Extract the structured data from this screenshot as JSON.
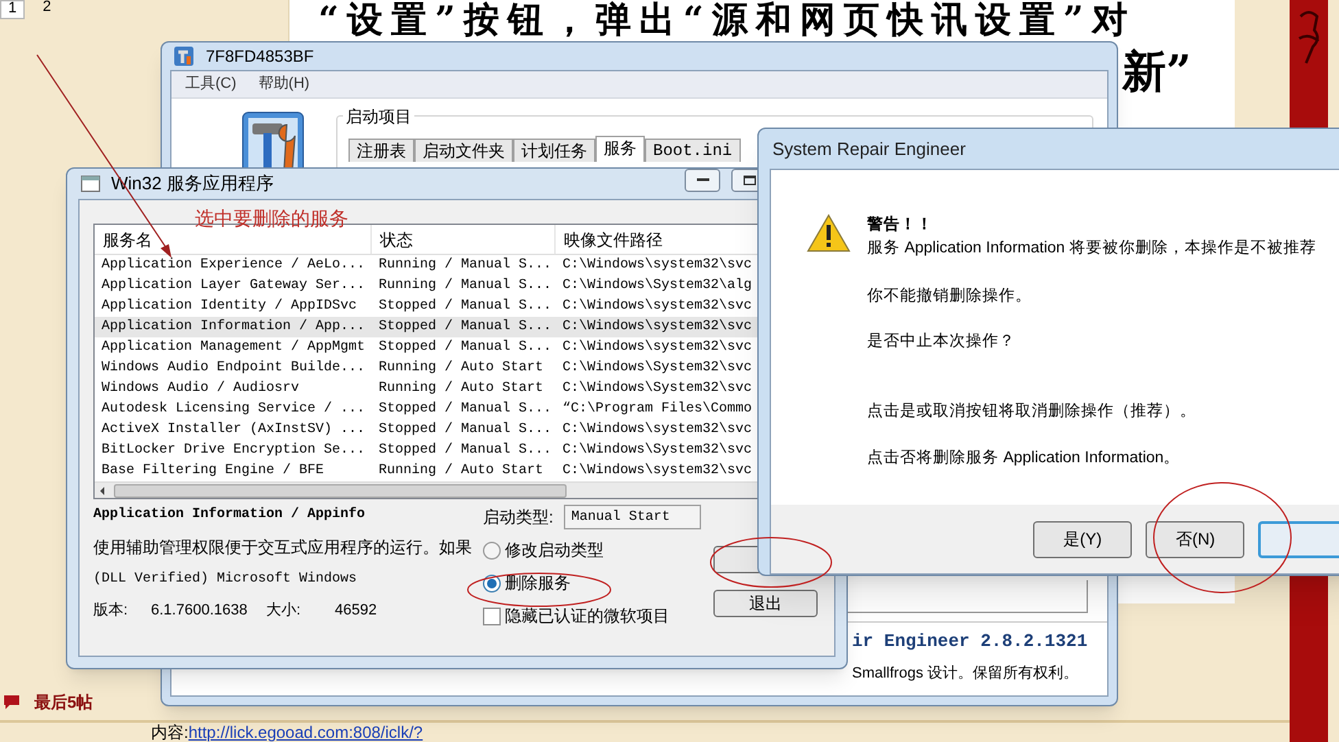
{
  "page": {
    "pagination": [
      {
        "label": "1",
        "selected": true
      },
      {
        "label": "2",
        "selected": false
      }
    ],
    "heading_line_1": "“设置”按钮，弹出“源和网页快讯设置”对",
    "heading_line_2": "新”",
    "recent_posts": "最后5帖",
    "content_label": "内容:",
    "content_link": "http://lick.egooad.com:808/iclk/?"
  },
  "main_window": {
    "title": "7F8FD4853BF",
    "menu": [
      "工具(C)",
      "帮助(H)"
    ],
    "group_title": "启动项目",
    "tabs": [
      {
        "label": "注册表",
        "selected": false
      },
      {
        "label": "启动文件夹",
        "selected": false
      },
      {
        "label": "计划任务",
        "selected": false
      },
      {
        "label": "服务",
        "selected": true
      },
      {
        "label": "Boot.ini",
        "selected": false
      }
    ],
    "product": "ir Engineer 2.8.2.1321",
    "copyright": "Smallfrogs 设计。保留所有权利。"
  },
  "services_window": {
    "title": "Win32 服务应用程序",
    "annotation": "选中要删除的服务",
    "table": {
      "columns": [
        "服务名",
        "状态",
        "映像文件路径"
      ],
      "rows": [
        {
          "cells": [
            "Application Experience / AeLo...",
            "Running / Manual S...",
            "C:\\Windows\\system32\\svc"
          ],
          "selected": false
        },
        {
          "cells": [
            "Application Layer Gateway Ser...",
            "Running / Manual S...",
            "C:\\Windows\\System32\\alg"
          ],
          "selected": false
        },
        {
          "cells": [
            "Application Identity / AppIDSvc",
            "Stopped / Manual S...",
            "C:\\Windows\\system32\\svc"
          ],
          "selected": false
        },
        {
          "cells": [
            "Application Information / App...",
            "Stopped / Manual S...",
            "C:\\Windows\\system32\\svc"
          ],
          "selected": true
        },
        {
          "cells": [
            "Application Management / AppMgmt",
            "Stopped / Manual S...",
            "C:\\Windows\\system32\\svc"
          ],
          "selected": false
        },
        {
          "cells": [
            "Windows Audio Endpoint Builde...",
            "Running / Auto Start",
            "C:\\Windows\\System32\\svc"
          ],
          "selected": false
        },
        {
          "cells": [
            "Windows Audio / Audiosrv",
            "Running / Auto Start",
            "C:\\Windows\\System32\\svc"
          ],
          "selected": false
        },
        {
          "cells": [
            "Autodesk Licensing Service / ...",
            "Stopped / Manual S...",
            "“C:\\Program Files\\Commo"
          ],
          "selected": false
        },
        {
          "cells": [
            "ActiveX Installer (AxInstSV) ...",
            "Stopped / Manual S...",
            "C:\\Windows\\system32\\svc"
          ],
          "selected": false
        },
        {
          "cells": [
            "BitLocker Drive Encryption Se...",
            "Stopped / Manual S...",
            "C:\\Windows\\System32\\svc"
          ],
          "selected": false
        },
        {
          "cells": [
            "Base Filtering Engine / BFE",
            "Running / Auto Start",
            "C:\\Windows\\system32\\svc"
          ],
          "selected": false
        }
      ]
    },
    "details": {
      "name": "Application Information / Appinfo",
      "description": "使用辅助管理权限便于交互式应用程序的运行。如果",
      "publisher": "(DLL Verified) Microsoft Windows",
      "version_label": "版本:",
      "version": "6.1.7600.1638",
      "size_label": "大小:",
      "size": "46592"
    },
    "startup_type_label": "启动类型:",
    "startup_type": "Manual Start",
    "options": [
      {
        "kind": "radio",
        "label": "修改启动类型",
        "selected": false
      },
      {
        "kind": "radio",
        "label": "删除服务",
        "selected": true
      },
      {
        "kind": "checkbox",
        "label": "隐藏已认证的微软项目",
        "checked": false
      }
    ],
    "exit_button": "退出"
  },
  "dialog": {
    "title": "System Repair Engineer",
    "heading": "警告！！",
    "message": "服务 Application Information 将要被你删除，本操作是不被推荐",
    "lines": [
      "你不能撤销删除操作。",
      "是否中止本次操作？",
      "点击是或取消按钮将取消删除操作（推荐）。",
      "点击否将删除服务 Application Information。"
    ],
    "buttons": [
      "是(Y)",
      "否(N)"
    ]
  }
}
